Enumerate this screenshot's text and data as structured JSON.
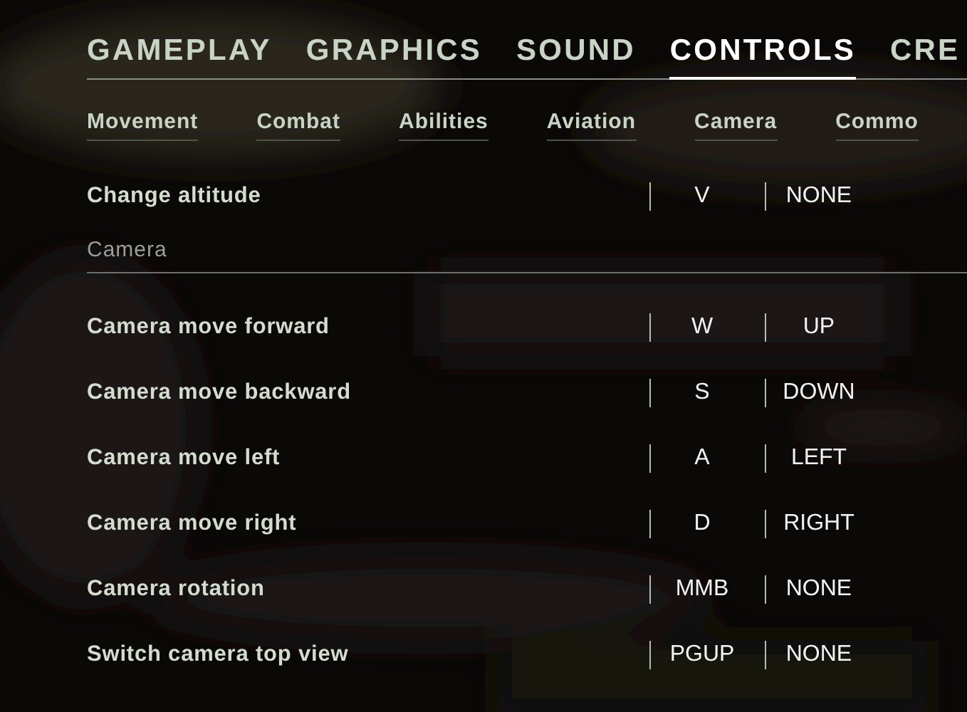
{
  "tabs": [
    {
      "label": "GAMEPLAY",
      "selected": false
    },
    {
      "label": "GRAPHICS",
      "selected": false
    },
    {
      "label": "SOUND",
      "selected": false
    },
    {
      "label": "CONTROLS",
      "selected": true
    },
    {
      "label": "CRE",
      "selected": false
    }
  ],
  "subtabs": [
    "Movement",
    "Combat",
    "Abilities",
    "Aviation",
    "Camera",
    "Commo"
  ],
  "rows": [
    {
      "kind": "binding",
      "action": "Change altitude",
      "primary": "V",
      "secondary": "NONE"
    },
    {
      "kind": "section",
      "label": "Camera"
    },
    {
      "kind": "binding",
      "action": "Camera move forward",
      "primary": "W",
      "secondary": "UP"
    },
    {
      "kind": "binding",
      "action": "Camera move backward",
      "primary": "S",
      "secondary": "DOWN"
    },
    {
      "kind": "binding",
      "action": "Camera move left",
      "primary": "A",
      "secondary": "LEFT"
    },
    {
      "kind": "binding",
      "action": "Camera move right",
      "primary": "D",
      "secondary": "RIGHT"
    },
    {
      "kind": "binding",
      "action": "Camera rotation",
      "primary": "MMB",
      "secondary": "NONE"
    },
    {
      "kind": "binding",
      "action": "Switch camera top view",
      "primary": "PGUP",
      "secondary": "NONE"
    }
  ]
}
